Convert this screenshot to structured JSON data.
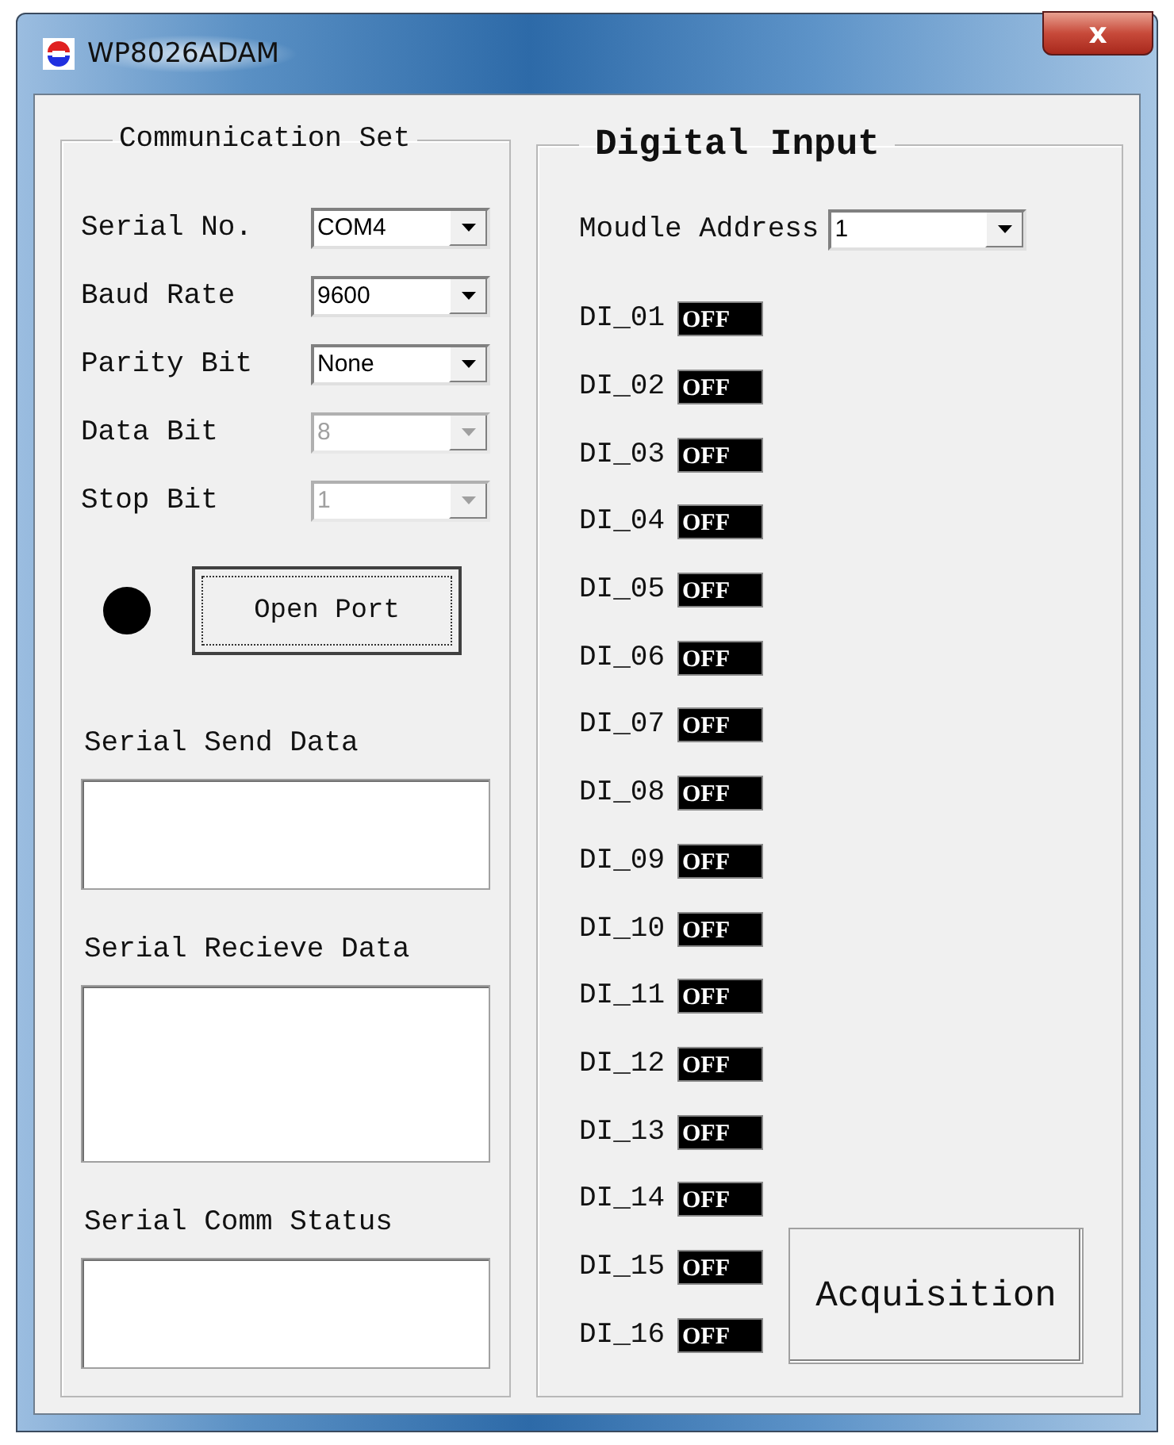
{
  "window": {
    "title": "WP8026ADAM",
    "close": "x"
  },
  "communication": {
    "title": "Communication Set",
    "settings": [
      {
        "label": "Serial No.",
        "value": "COM4",
        "disabled": false
      },
      {
        "label": "Baud Rate",
        "value": "9600",
        "disabled": false
      },
      {
        "label": "Parity Bit",
        "value": "None",
        "disabled": false
      },
      {
        "label": "Data Bit",
        "value": "8",
        "disabled": true
      },
      {
        "label": "Stop Bit",
        "value": "1",
        "disabled": true
      }
    ],
    "port_indicator": {
      "on": false
    },
    "open_button": "Open Port",
    "send_label": "Serial Send Data",
    "receive_label": "Serial Recieve Data",
    "status_label": "Serial Comm Status"
  },
  "digital_input": {
    "title": "Digital Input",
    "address_label": "Moudle Address",
    "address": "1",
    "inputs": [
      {
        "label": "DI_01",
        "value": "OFF",
        "on": false
      },
      {
        "label": "DI_02",
        "value": "OFF",
        "on": false
      },
      {
        "label": "DI_03",
        "value": "OFF",
        "on": false
      },
      {
        "label": "DI_04",
        "value": "OFF",
        "on": false
      },
      {
        "label": "DI_05",
        "value": "OFF",
        "on": false
      },
      {
        "label": "DI_06",
        "value": "OFF",
        "on": false
      },
      {
        "label": "DI_07",
        "value": "OFF",
        "on": false
      },
      {
        "label": "DI_08",
        "value": "OFF",
        "on": false
      },
      {
        "label": "DI_09",
        "value": "OFF",
        "on": false
      },
      {
        "label": "DI_10",
        "value": "OFF",
        "on": false
      },
      {
        "label": "DI_11",
        "value": "OFF",
        "on": false
      },
      {
        "label": "DI_12",
        "value": "OFF",
        "on": false
      },
      {
        "label": "DI_13",
        "value": "OFF",
        "on": false
      },
      {
        "label": "DI_14",
        "value": "OFF",
        "on": false
      },
      {
        "label": "DI_15",
        "value": "OFF",
        "on": false
      },
      {
        "label": "DI_16",
        "value": "OFF",
        "on": false
      }
    ],
    "acquire_button": "Acquisition"
  }
}
